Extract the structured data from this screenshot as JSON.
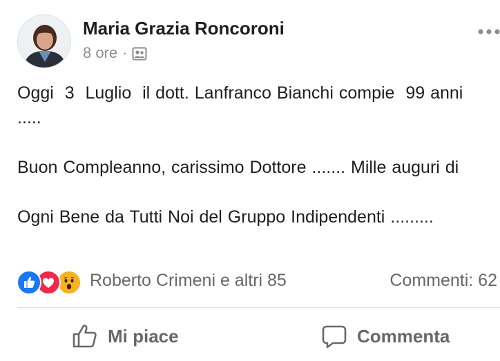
{
  "post": {
    "author": "Maria Grazia Roncoroni",
    "timestamp": "8 ore",
    "separator": "·",
    "privacy_icon": "group-audience-icon",
    "more_icon": "more-options-icon",
    "paragraphs": [
      "Oggi  3  Luglio  il dott. Lanfranco Bianchi compie  99 anni  .....",
      "Buon Compleanno, carissimo Dottore ....... Mille auguri di",
      "Ogni Bene da Tutti Noi del Gruppo Indipendenti ........."
    ]
  },
  "reactions": {
    "icons": [
      "like-reaction-icon",
      "love-reaction-icon",
      "wow-reaction-icon"
    ],
    "summary": "Roberto Crimeni e altri 85",
    "comments": "Commenti: 62"
  },
  "actions": {
    "like_label": "Mi piace",
    "comment_label": "Commenta"
  },
  "colors": {
    "like_blue": "#1877f2",
    "love_red": "#f0284a",
    "wow_yellow": "#f7b125",
    "secondary_text": "#65676b"
  }
}
